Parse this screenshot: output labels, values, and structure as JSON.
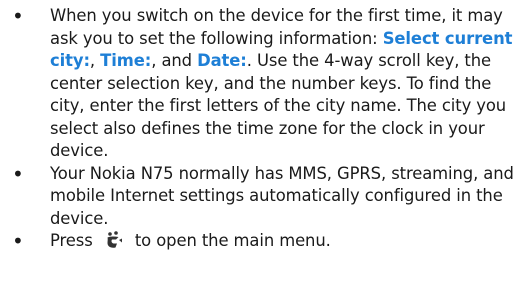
{
  "items": [
    {
      "intro": "When you switch on the device for the first time, it may ask you to set the following information: ",
      "highlight_1": "Select current city:",
      "sep_1": ", ",
      "highlight_2": "Time:",
      "sep_2": ", and ",
      "highlight_3": "Date:",
      "rest": ". Use the 4-way scroll key, the center selection key, and the number keys. To find the city, enter the first letters of the city name. The city you select also defines the time zone for the clock in your device."
    },
    {
      "text": "Your Nokia N75 normally has MMS, GPRS, streaming, and mobile Internet settings automatically configured in the device."
    },
    {
      "before_icon": "Press ",
      "icon": "menu-key-icon",
      "after_icon": " to open the main menu."
    }
  ],
  "colors": {
    "highlight": "#1e7fd6",
    "text": "#1a1a1a"
  }
}
